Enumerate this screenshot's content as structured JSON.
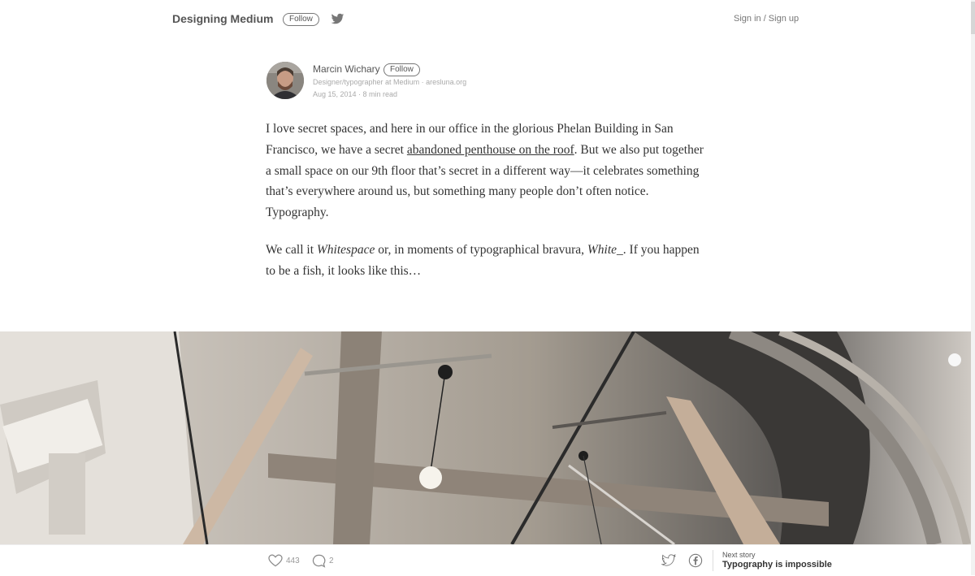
{
  "header": {
    "publication": "Designing Medium",
    "follow_label": "Follow",
    "twitter_icon": "twitter-icon",
    "signin": "Sign in / Sign up"
  },
  "author": {
    "name": "Marcin Wichary",
    "follow_label": "Follow",
    "bio": "Designer/typographer at Medium · aresluna.org",
    "meta": "Aug 15, 2014 · 8 min read"
  },
  "article": {
    "p1_a": "I love secret spaces, and here in our office in the glorious Phelan Building in San Francisco, we have a secret ",
    "p1_link": "abandoned penthouse on the roof",
    "p1_b": ". But we also put together a small space on our 9th floor that’s secret in a different way—it celebrates something that’s everywhere around us, but something many people don’t often notice. Typography.",
    "p2_a": "We call it ",
    "p2_em1": "Whitespace",
    "p2_b": " or, in moments of typographical bravura, ",
    "p2_em2": "White_",
    "p2_c": ". If you happen to be a fish, it looks like this…"
  },
  "footer": {
    "likes": "443",
    "comments": "2",
    "next_label": "Next story",
    "next_title": "Typography is impossible"
  },
  "colors": {
    "text": "#333333",
    "muted": "#aaaaaa",
    "background": "#ffffff"
  }
}
